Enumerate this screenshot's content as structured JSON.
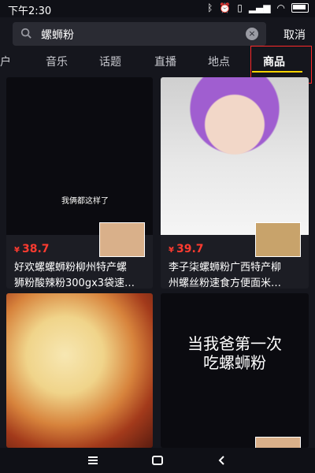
{
  "status": {
    "time": "下午2:30",
    "icons": [
      "bluetooth-icon",
      "alarm-icon",
      "vibrate-icon",
      "signal-icon",
      "wifi-icon",
      "battery-icon"
    ]
  },
  "search": {
    "query": "螺蛳粉",
    "cancel_label": "取消"
  },
  "tabs": [
    {
      "label": "户"
    },
    {
      "label": "音乐"
    },
    {
      "label": "话题"
    },
    {
      "label": "直播"
    },
    {
      "label": "地点"
    },
    {
      "label": "商品"
    }
  ],
  "cards": [
    {
      "subtitle": "我俩都这样了",
      "price_symbol": "¥",
      "price": "38.7",
      "title_line1": "好欢螺螺蛳粉柳州特产螺",
      "title_line2": "狮粉酸辣粉300gx3袋速…"
    },
    {
      "price_symbol": "¥",
      "price": "39.7",
      "title_line1": "李子柒螺蛳粉广西特产柳",
      "title_line2": "州螺丝粉速食方便面米…"
    },
    {
      "type": "image"
    },
    {
      "overlay_line1": "当我爸第一次",
      "overlay_line2": "吃螺蛳粉"
    }
  ],
  "colors": {
    "background": "#15161d",
    "accent_tab_underline": "#ffd400",
    "price": "#ff3b30",
    "highlight_box": "#ff2a2a"
  }
}
